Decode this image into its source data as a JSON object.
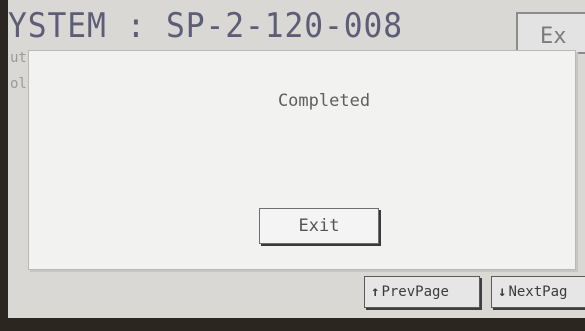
{
  "header": {
    "title": "YSTEM : SP-2-120-008",
    "exit_label": "Ex"
  },
  "side_labels": [
    "ut",
    "ol"
  ],
  "dialog": {
    "message": "Completed",
    "exit_label": "Exit"
  },
  "pager": {
    "prev_label": "PrevPage",
    "next_label": "NextPag"
  }
}
